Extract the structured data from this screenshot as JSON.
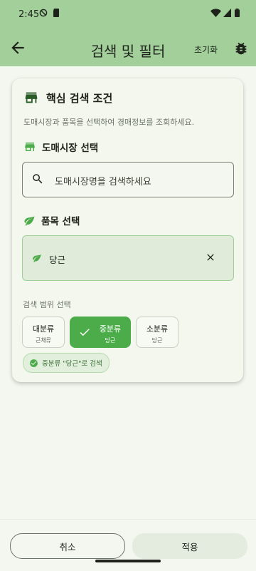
{
  "status_bar": {
    "time": "2:45"
  },
  "app_bar": {
    "title": "검색 및 필터",
    "reset_label": "초기화"
  },
  "card": {
    "title": "핵심 검색 조건",
    "description": "도매시장과 품목을 선택하여 경매정보를 조회하세요.",
    "market_section": {
      "title": "도매시장 선택",
      "search_placeholder": "도매시장명을 검색하세요"
    },
    "item_section": {
      "title": "품목 선택",
      "selected_item": "당근"
    },
    "range": {
      "label": "검색 범위 선택",
      "options": [
        {
          "label": "대분류",
          "sub": "근채류",
          "selected": false
        },
        {
          "label": "중분류",
          "sub": "당근",
          "selected": true
        },
        {
          "label": "소분류",
          "sub": "당근",
          "selected": false
        }
      ],
      "info": "중분류 \"당근\"로 검색"
    }
  },
  "bottom": {
    "cancel_label": "취소",
    "apply_label": "적용"
  },
  "colors": {
    "app_bar": "#a3cf9b",
    "accent": "#4cac4a",
    "selected_chip": "#e0ebd9",
    "background": "#f4f7ef"
  }
}
